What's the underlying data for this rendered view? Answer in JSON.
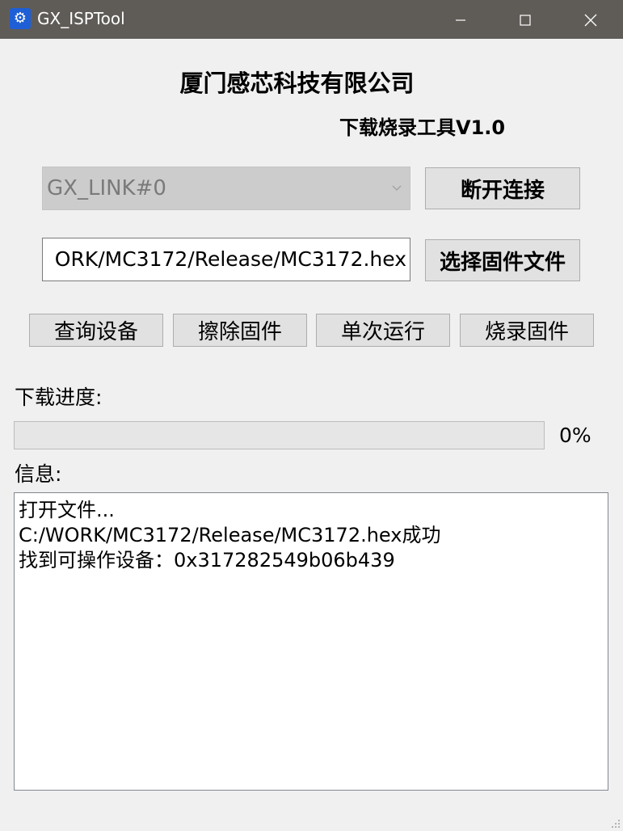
{
  "window": {
    "title": "GX_ISPTool",
    "icon": "gear-icon",
    "controls": [
      "minimize-icon",
      "maximize-icon",
      "close-icon"
    ]
  },
  "header": {
    "company": "厦门感芯科技有限公司",
    "subtitle": "下载烧录工具V1.0"
  },
  "device": {
    "selected": "GX_LINK#0",
    "disconnect_label": "断开连接"
  },
  "firmware": {
    "path_visible": "ORK/MC3172/Release/MC3172.hex",
    "choose_label": "选择固件文件"
  },
  "actions": {
    "query_label": "查询设备",
    "erase_label": "擦除固件",
    "run_once_label": "单次运行",
    "burn_label": "烧录固件"
  },
  "progress": {
    "label": "下载进度:",
    "value": 0,
    "value_text": "0%"
  },
  "info": {
    "label": "信息:",
    "lines": [
      "打开文件...",
      "C:/WORK/MC3172/Release/MC3172.hex成功",
      "找到可操作设备：0x317282549b06b439"
    ]
  },
  "colors": {
    "titlebar": "#5f5c58",
    "window_bg": "#f0f0f0",
    "button_bg": "#e1e1e1",
    "combo_disabled_bg": "#cccccc",
    "progress_fill": "#06b025"
  }
}
